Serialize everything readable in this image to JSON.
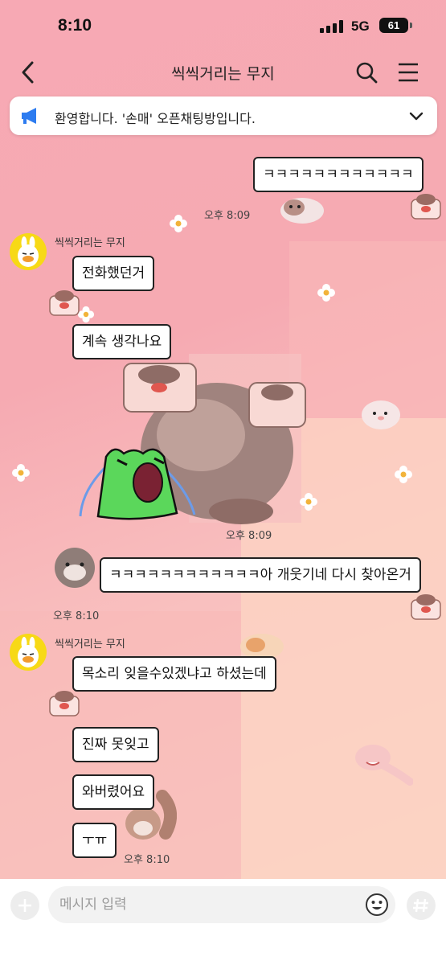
{
  "status_bar": {
    "time": "8:10",
    "network": "5G",
    "battery": "61"
  },
  "header": {
    "title": "씩씩거리는 무지"
  },
  "notice": {
    "text": "환영합니다. '손매' 오픈채팅방입니다."
  },
  "messages": {
    "m1": {
      "text": "ㅋㅋㅋㅋㅋㅋㅋㅋㅋㅋㅋㅋ",
      "time": "오후 8:09"
    },
    "group1": {
      "sender": "씩씩거리는 무지",
      "b1": "전화했던거",
      "b2": "계속 생각나요",
      "time": "오후 8:09"
    },
    "m2": {
      "text": "ㅋㅋㅋㅋㅋㅋㅋㅋㅋㅋㅋㅋ아 개웃기네 다시 찾아온거",
      "time": "오후 8:10"
    },
    "group2": {
      "sender": "씩씩거리는 무지",
      "b1": "목소리 잊을수있겠냐고 하셨는데",
      "b2": "진짜 못잊고",
      "b3": "와버렸어요",
      "b4": "ㅜㅠ",
      "time": "오후 8:10"
    }
  },
  "composer": {
    "placeholder": "메시지 입력"
  },
  "colors": {
    "bg_pink": "#f7a9b4",
    "bg_peach": "#fcd7c6",
    "avatar_yellow": "#f7d916",
    "notice_icon": "#2d7cf0",
    "frog_green": "#5bd75b"
  },
  "icons": [
    "back-arrow-icon",
    "search-icon",
    "menu-icon",
    "megaphone-icon",
    "chevron-down-icon",
    "plus-icon",
    "emoji-icon",
    "hash-icon",
    "muzi-avatar-icon",
    "hamster-sticker-icon",
    "flower-icon",
    "frog-crying-sticker-icon"
  ]
}
